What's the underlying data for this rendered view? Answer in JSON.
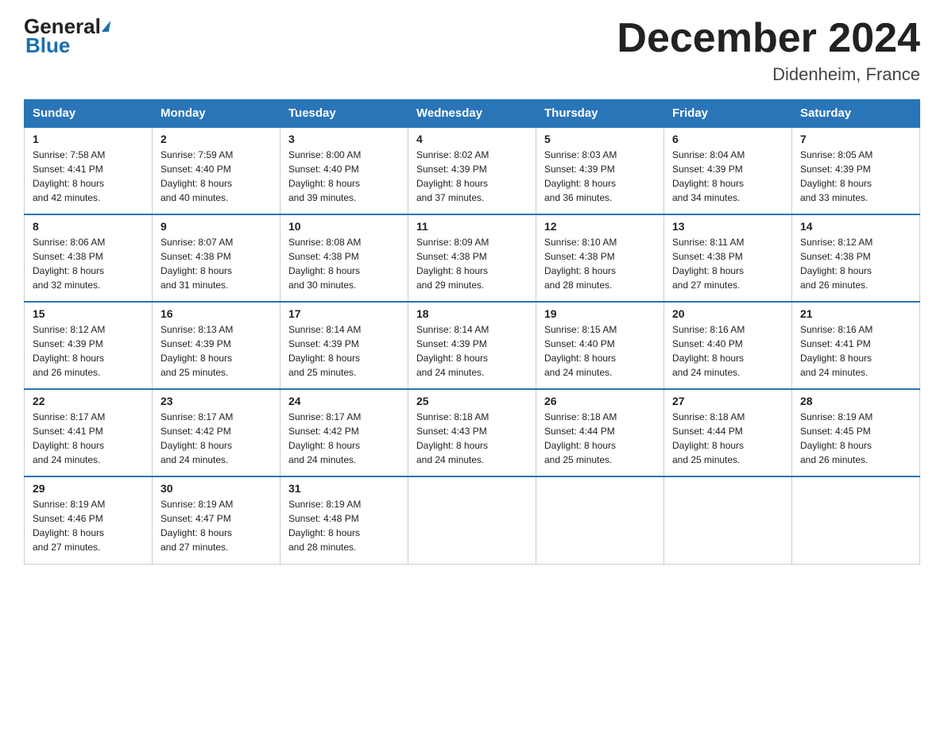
{
  "logo": {
    "general": "General",
    "blue": "Blue"
  },
  "title": {
    "month": "December 2024",
    "location": "Didenheim, France"
  },
  "headers": [
    "Sunday",
    "Monday",
    "Tuesday",
    "Wednesday",
    "Thursday",
    "Friday",
    "Saturday"
  ],
  "weeks": [
    [
      {
        "day": "1",
        "info": "Sunrise: 7:58 AM\nSunset: 4:41 PM\nDaylight: 8 hours\nand 42 minutes."
      },
      {
        "day": "2",
        "info": "Sunrise: 7:59 AM\nSunset: 4:40 PM\nDaylight: 8 hours\nand 40 minutes."
      },
      {
        "day": "3",
        "info": "Sunrise: 8:00 AM\nSunset: 4:40 PM\nDaylight: 8 hours\nand 39 minutes."
      },
      {
        "day": "4",
        "info": "Sunrise: 8:02 AM\nSunset: 4:39 PM\nDaylight: 8 hours\nand 37 minutes."
      },
      {
        "day": "5",
        "info": "Sunrise: 8:03 AM\nSunset: 4:39 PM\nDaylight: 8 hours\nand 36 minutes."
      },
      {
        "day": "6",
        "info": "Sunrise: 8:04 AM\nSunset: 4:39 PM\nDaylight: 8 hours\nand 34 minutes."
      },
      {
        "day": "7",
        "info": "Sunrise: 8:05 AM\nSunset: 4:39 PM\nDaylight: 8 hours\nand 33 minutes."
      }
    ],
    [
      {
        "day": "8",
        "info": "Sunrise: 8:06 AM\nSunset: 4:38 PM\nDaylight: 8 hours\nand 32 minutes."
      },
      {
        "day": "9",
        "info": "Sunrise: 8:07 AM\nSunset: 4:38 PM\nDaylight: 8 hours\nand 31 minutes."
      },
      {
        "day": "10",
        "info": "Sunrise: 8:08 AM\nSunset: 4:38 PM\nDaylight: 8 hours\nand 30 minutes."
      },
      {
        "day": "11",
        "info": "Sunrise: 8:09 AM\nSunset: 4:38 PM\nDaylight: 8 hours\nand 29 minutes."
      },
      {
        "day": "12",
        "info": "Sunrise: 8:10 AM\nSunset: 4:38 PM\nDaylight: 8 hours\nand 28 minutes."
      },
      {
        "day": "13",
        "info": "Sunrise: 8:11 AM\nSunset: 4:38 PM\nDaylight: 8 hours\nand 27 minutes."
      },
      {
        "day": "14",
        "info": "Sunrise: 8:12 AM\nSunset: 4:38 PM\nDaylight: 8 hours\nand 26 minutes."
      }
    ],
    [
      {
        "day": "15",
        "info": "Sunrise: 8:12 AM\nSunset: 4:39 PM\nDaylight: 8 hours\nand 26 minutes."
      },
      {
        "day": "16",
        "info": "Sunrise: 8:13 AM\nSunset: 4:39 PM\nDaylight: 8 hours\nand 25 minutes."
      },
      {
        "day": "17",
        "info": "Sunrise: 8:14 AM\nSunset: 4:39 PM\nDaylight: 8 hours\nand 25 minutes."
      },
      {
        "day": "18",
        "info": "Sunrise: 8:14 AM\nSunset: 4:39 PM\nDaylight: 8 hours\nand 24 minutes."
      },
      {
        "day": "19",
        "info": "Sunrise: 8:15 AM\nSunset: 4:40 PM\nDaylight: 8 hours\nand 24 minutes."
      },
      {
        "day": "20",
        "info": "Sunrise: 8:16 AM\nSunset: 4:40 PM\nDaylight: 8 hours\nand 24 minutes."
      },
      {
        "day": "21",
        "info": "Sunrise: 8:16 AM\nSunset: 4:41 PM\nDaylight: 8 hours\nand 24 minutes."
      }
    ],
    [
      {
        "day": "22",
        "info": "Sunrise: 8:17 AM\nSunset: 4:41 PM\nDaylight: 8 hours\nand 24 minutes."
      },
      {
        "day": "23",
        "info": "Sunrise: 8:17 AM\nSunset: 4:42 PM\nDaylight: 8 hours\nand 24 minutes."
      },
      {
        "day": "24",
        "info": "Sunrise: 8:17 AM\nSunset: 4:42 PM\nDaylight: 8 hours\nand 24 minutes."
      },
      {
        "day": "25",
        "info": "Sunrise: 8:18 AM\nSunset: 4:43 PM\nDaylight: 8 hours\nand 24 minutes."
      },
      {
        "day": "26",
        "info": "Sunrise: 8:18 AM\nSunset: 4:44 PM\nDaylight: 8 hours\nand 25 minutes."
      },
      {
        "day": "27",
        "info": "Sunrise: 8:18 AM\nSunset: 4:44 PM\nDaylight: 8 hours\nand 25 minutes."
      },
      {
        "day": "28",
        "info": "Sunrise: 8:19 AM\nSunset: 4:45 PM\nDaylight: 8 hours\nand 26 minutes."
      }
    ],
    [
      {
        "day": "29",
        "info": "Sunrise: 8:19 AM\nSunset: 4:46 PM\nDaylight: 8 hours\nand 27 minutes."
      },
      {
        "day": "30",
        "info": "Sunrise: 8:19 AM\nSunset: 4:47 PM\nDaylight: 8 hours\nand 27 minutes."
      },
      {
        "day": "31",
        "info": "Sunrise: 8:19 AM\nSunset: 4:48 PM\nDaylight: 8 hours\nand 28 minutes."
      },
      null,
      null,
      null,
      null
    ]
  ]
}
